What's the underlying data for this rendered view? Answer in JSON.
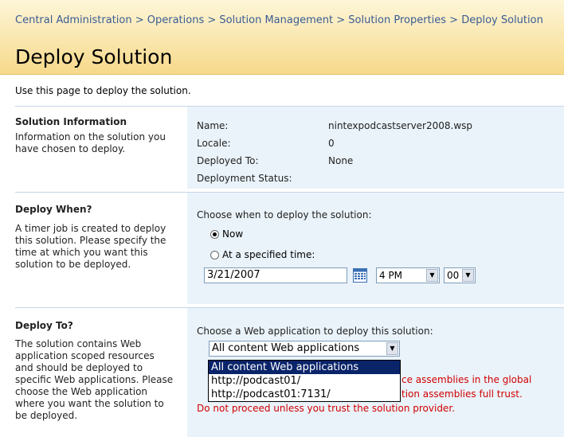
{
  "breadcrumb": {
    "text": "Central Administration > Operations > Solution Management > Solution Properties > Deploy Solution"
  },
  "page": {
    "title": "Deploy Solution",
    "intro": "Use this page to deploy the solution."
  },
  "solution_info": {
    "heading": "Solution Information",
    "description": "Information on the solution you have chosen to deploy.",
    "name_label": "Name:",
    "name_value": "nintexpodcastserver2008.wsp",
    "locale_label": "Locale:",
    "locale_value": "0",
    "deployed_to_label": "Deployed To:",
    "deployed_to_value": "None",
    "status_label": "Deployment Status:"
  },
  "deploy_when": {
    "heading": "Deploy When?",
    "description": "A timer job is created to deploy this solution. Please specify the time at which you want this solution to be deployed.",
    "prompt": "Choose when to deploy the solution:",
    "option_now": "Now",
    "option_specified": "At a specified time:",
    "date_value": "3/21/2007",
    "hour_value": "4 PM",
    "minute_value": "00",
    "selected": "now"
  },
  "deploy_to": {
    "heading": "Deploy To?",
    "description": "The solution contains Web application scoped resources and should be deployed to specific Web applications. Please choose the Web application where you want the solution to be deployed.",
    "prompt": "Choose a Web application to deploy this solution:",
    "selected_app": "All content Web applications",
    "options": [
      "All content Web applications",
      "http://podcast01/",
      "http://podcast01:7131/"
    ],
    "warning_line1": "ce assemblies in the global",
    "warning_line2": "tion assemblies full trust.",
    "warning_line3": "Do not proceed unless you trust the solution provider."
  },
  "colors": {
    "link": "#3a5c94",
    "warning": "#d10000",
    "section_bg": "#eaf3fa",
    "highlight": "#0a246a"
  }
}
